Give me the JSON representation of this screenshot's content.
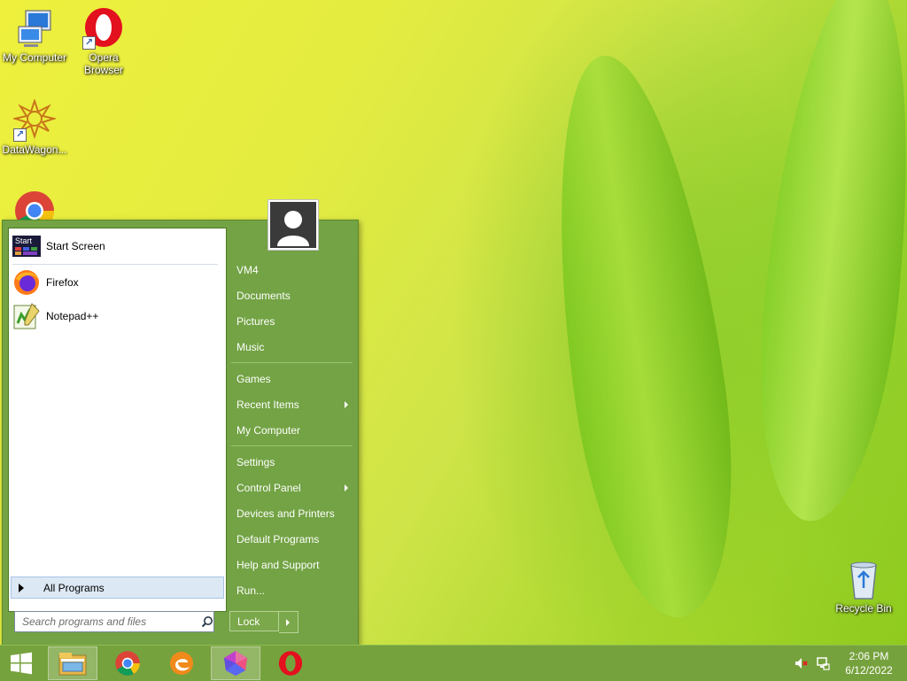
{
  "desktop": {
    "icons": [
      {
        "label": "My Computer",
        "icon": "computer-icon"
      },
      {
        "label": "Opera Browser",
        "icon": "opera-icon"
      },
      {
        "label": "DataWagon...",
        "icon": "datawagon-icon"
      },
      {
        "label": "Recycle Bin",
        "icon": "recycle-bin-icon"
      }
    ]
  },
  "start_menu": {
    "programs": [
      {
        "label": "Start Screen",
        "icon": "start-screen-icon",
        "tile_text": "Start"
      },
      {
        "label": "Firefox",
        "icon": "firefox-icon"
      },
      {
        "label": "Notepad++",
        "icon": "notepadpp-icon"
      }
    ],
    "all_programs": "All Programs",
    "search_placeholder": "Search programs and files",
    "user_name": "VM4",
    "right_items": [
      {
        "label": "Documents"
      },
      {
        "label": "Pictures"
      },
      {
        "label": "Music"
      },
      {
        "label": "Games"
      },
      {
        "label": "Recent Items",
        "submenu": true
      },
      {
        "label": "My Computer"
      },
      {
        "label": "Settings"
      },
      {
        "label": "Control Panel",
        "submenu": true
      },
      {
        "label": "Devices and Printers"
      },
      {
        "label": "Default Programs"
      },
      {
        "label": "Help and Support"
      },
      {
        "label": "Run..."
      }
    ],
    "lock_label": "Lock"
  },
  "taskbar": {
    "buttons": [
      {
        "icon": "windows-start-icon"
      },
      {
        "icon": "file-explorer-icon"
      },
      {
        "icon": "chrome-icon"
      },
      {
        "icon": "edge-icon"
      },
      {
        "icon": "app-gem-icon"
      },
      {
        "icon": "opera-icon"
      }
    ],
    "tray": {
      "time": "2:06 PM",
      "date": "6/12/2022"
    }
  },
  "colors": {
    "menu_green": "#73a344",
    "taskbar_green": "#76a23d"
  }
}
